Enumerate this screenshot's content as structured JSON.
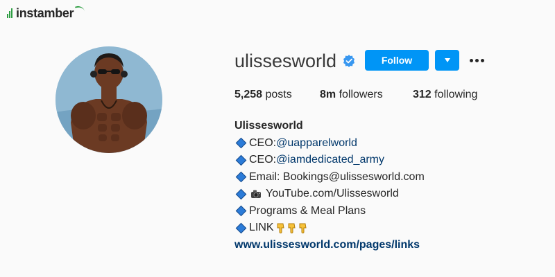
{
  "theme": {
    "background": "#fafafa",
    "accent": "#0095f6",
    "link": "#00376b",
    "text": "#262626"
  },
  "watermark": {
    "text": "instamber"
  },
  "profile": {
    "username": "ulissesworld",
    "verified": true,
    "follow_label": "Follow",
    "posts_count": "5,258",
    "posts_label": "posts",
    "followers_count": "8m",
    "followers_label": "followers",
    "following_count": "312",
    "following_label": "following"
  },
  "bio": {
    "name": "Ulissesworld",
    "ceo1_prefix": "CEO: ",
    "ceo1_handle": "@uapparelworld",
    "ceo2_prefix": "CEO: ",
    "ceo2_handle": "@iamdedicated_army",
    "email": "Email: Bookings@ulissesworld.com",
    "youtube": "YouTube.com/Ulissesworld",
    "programs": "Programs & Meal Plans",
    "link_label": "LINK",
    "website": "www.ulissesworld.com/pages/links"
  },
  "icons": [
    "verified-badge-icon",
    "caret-down-icon",
    "more-options-icon",
    "diamond-icon",
    "camera-icon",
    "pointing-down-icon"
  ]
}
